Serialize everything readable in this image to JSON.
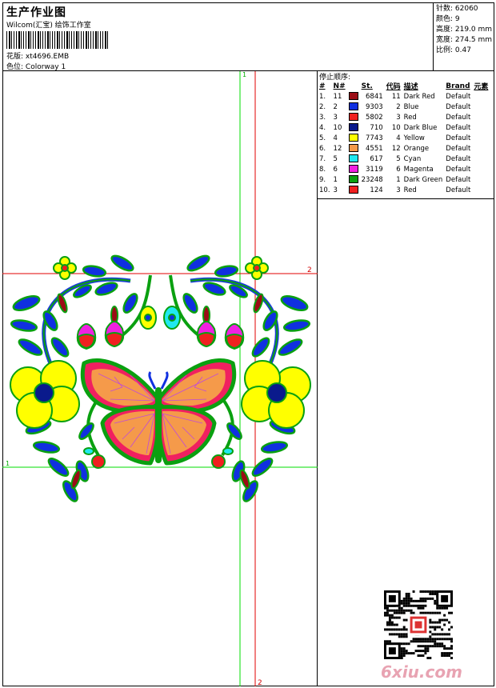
{
  "header": {
    "title": "生产作业图",
    "company": "Wilcom(汇宝) 绘饰工作室",
    "design_label": "花版:",
    "design_value": "xt4696.EMB",
    "color_label": "色位:",
    "color_value": "Colorway 1"
  },
  "stats": {
    "stitches": "针数: 62060",
    "colors": "颜色: 9",
    "height": "高度: 219.0 mm",
    "width": "宽度: 274.5 mm",
    "scale": "比例: 0.47"
  },
  "sequence": {
    "title": "停止顺序:",
    "headers": [
      "#",
      "N#",
      "",
      "St.",
      "代码",
      "描述",
      "Brand",
      "元素"
    ],
    "rows": [
      {
        "idx": "1.",
        "n": "11",
        "color": "#9b0d16",
        "st": "6841",
        "code": "11",
        "desc": "Dark Red",
        "brand": "Default"
      },
      {
        "idx": "2.",
        "n": "2",
        "color": "#1030e0",
        "st": "9303",
        "code": "2",
        "desc": "Blue",
        "brand": "Default"
      },
      {
        "idx": "3.",
        "n": "3",
        "color": "#f02020",
        "st": "5802",
        "code": "3",
        "desc": "Red",
        "brand": "Default"
      },
      {
        "idx": "4.",
        "n": "10",
        "color": "#0a1a8c",
        "st": "710",
        "code": "10",
        "desc": "Dark Blue",
        "brand": "Default"
      },
      {
        "idx": "5.",
        "n": "4",
        "color": "#ffff00",
        "st": "7743",
        "code": "4",
        "desc": "Yellow",
        "brand": "Default"
      },
      {
        "idx": "6.",
        "n": "12",
        "color": "#f59a4a",
        "st": "4551",
        "code": "12",
        "desc": "Orange",
        "brand": "Default"
      },
      {
        "idx": "7.",
        "n": "5",
        "color": "#20e8f0",
        "st": "617",
        "code": "5",
        "desc": "Cyan",
        "brand": "Default"
      },
      {
        "idx": "8.",
        "n": "6",
        "color": "#f020e0",
        "st": "3119",
        "code": "6",
        "desc": "Magenta",
        "brand": "Default"
      },
      {
        "idx": "9.",
        "n": "1",
        "color": "#0aa010",
        "st": "23248",
        "code": "1",
        "desc": "Dark Green",
        "brand": "Default"
      },
      {
        "idx": "10.",
        "n": "3",
        "color": "#f02020",
        "st": "124",
        "code": "3",
        "desc": "Red",
        "brand": "Default"
      }
    ]
  },
  "guides": {
    "green_top": "1",
    "red_right": "2",
    "green_left": "1",
    "red_bottom": "2"
  },
  "watermark": "6xiu.com"
}
